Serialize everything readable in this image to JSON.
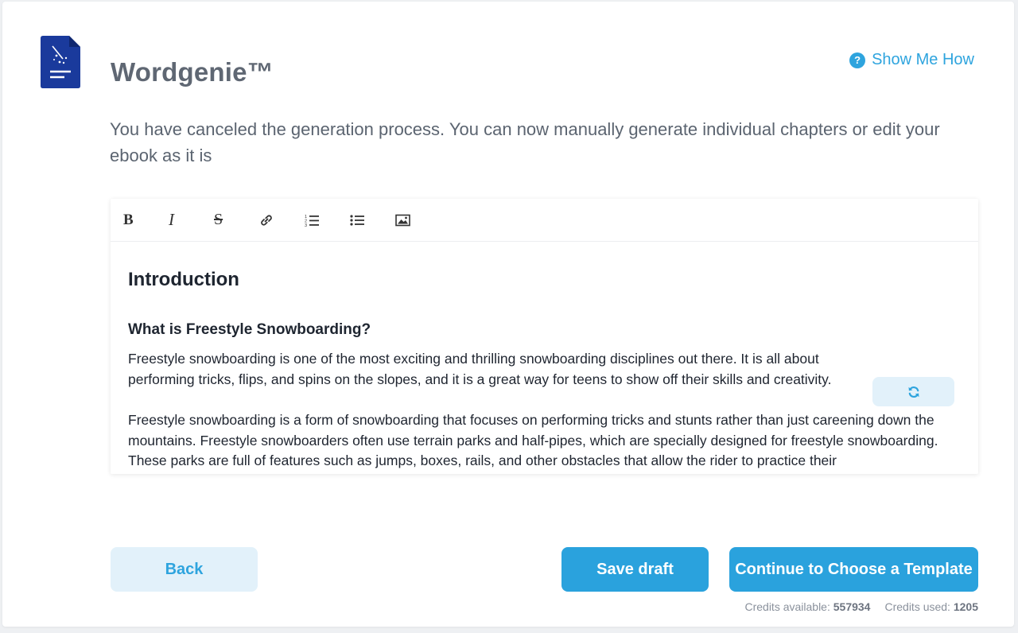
{
  "app": {
    "title": "Wordgenie™",
    "help_label": "Show Me How"
  },
  "message": "You have canceled the generation process. You can now manually generate individual chapters or edit your ebook as it is",
  "toolbar": {
    "bold": "B",
    "italic": "I",
    "strikethrough": "S",
    "icons": [
      "bold-icon",
      "italic-icon",
      "strikethrough-icon",
      "link-icon",
      "ordered-list-icon",
      "bullet-list-icon",
      "image-icon"
    ]
  },
  "content": {
    "heading": "Introduction",
    "subheading": "What is Freestyle Snowboarding?",
    "paragraph1": "Freestyle snowboarding is one of the most exciting and thrilling snowboarding disciplines out there. It is all about performing tricks, flips, and spins on the slopes, and it is a great way for teens to show off their skills and creativity.",
    "paragraph2": "Freestyle snowboarding is a form of snowboarding that focuses on performing tricks and stunts rather than just careening down the mountains. Freestyle snowboarders often use terrain parks and half-pipes, which are specially designed for freestyle snowboarding. These parks are full of features such as jumps, boxes, rails, and other obstacles that allow the rider to practice their"
  },
  "buttons": {
    "back": "Back",
    "save_draft": "Save draft",
    "continue": "Continue to Choose a Template"
  },
  "credits": {
    "available_label": "Credits available:",
    "available_value": "557934",
    "used_label": "Credits used:",
    "used_value": "1205"
  },
  "colors": {
    "accent": "#2aa2dd",
    "accent_light": "#e2f1fa",
    "logo": "#1a3a9c",
    "title": "#5f6773"
  }
}
